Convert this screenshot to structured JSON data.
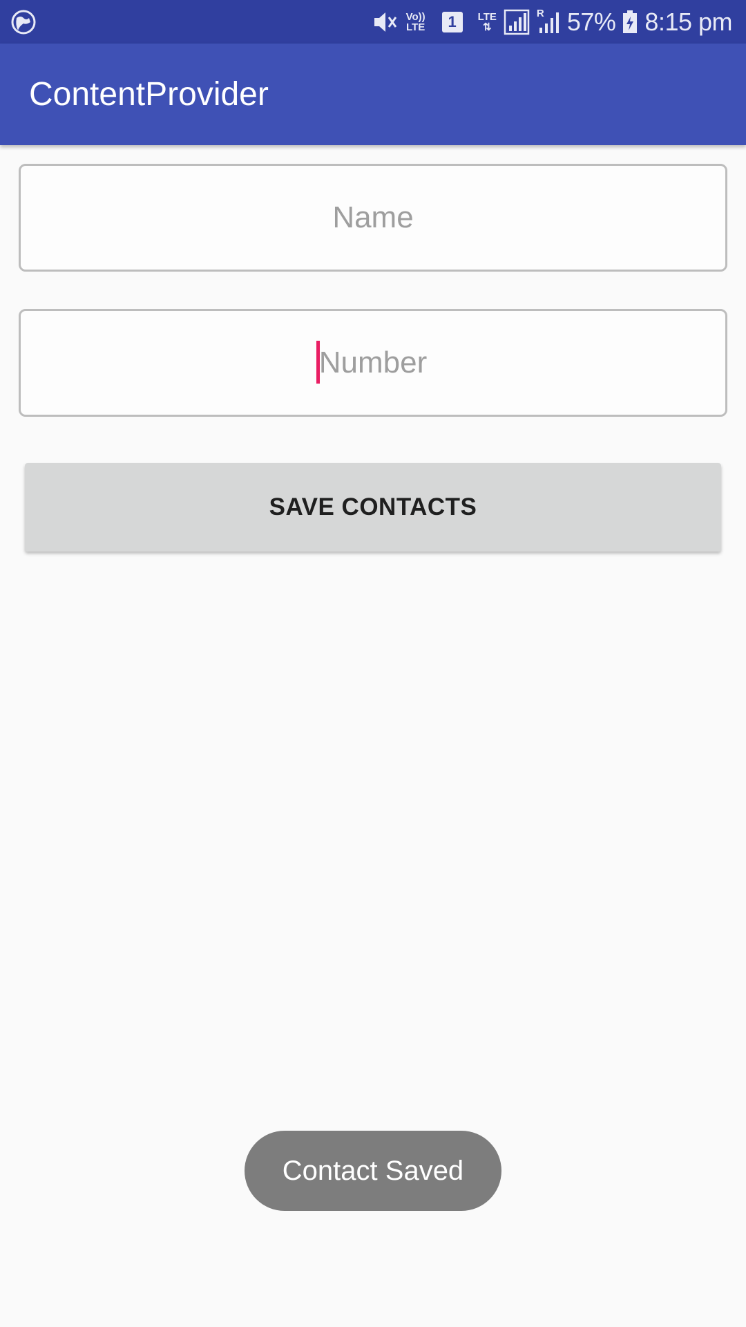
{
  "status_bar": {
    "battery_percent": "57%",
    "time": "8:15 pm",
    "volte_top": "Vo))",
    "volte_bottom": "LTE",
    "sim_label": "1",
    "lte_label": "LTE",
    "roaming_label": "R",
    "icons": [
      "globe-icon",
      "mute-icon",
      "volte-icon",
      "sim-icon",
      "lte-signal-icon",
      "signal-icon",
      "battery-icon"
    ]
  },
  "app_bar": {
    "title": "ContentProvider"
  },
  "form": {
    "name_placeholder": "Name",
    "name_value": "",
    "number_placeholder": "Number",
    "number_value": "",
    "save_label": "SAVE CONTACTS"
  },
  "toast": {
    "message": "Contact Saved"
  },
  "colors": {
    "status_bar": "#303f9f",
    "app_bar": "#3f51b5",
    "cursor": "#e91e63",
    "button": "#d6d7d7",
    "toast": "#7d7d7d"
  }
}
